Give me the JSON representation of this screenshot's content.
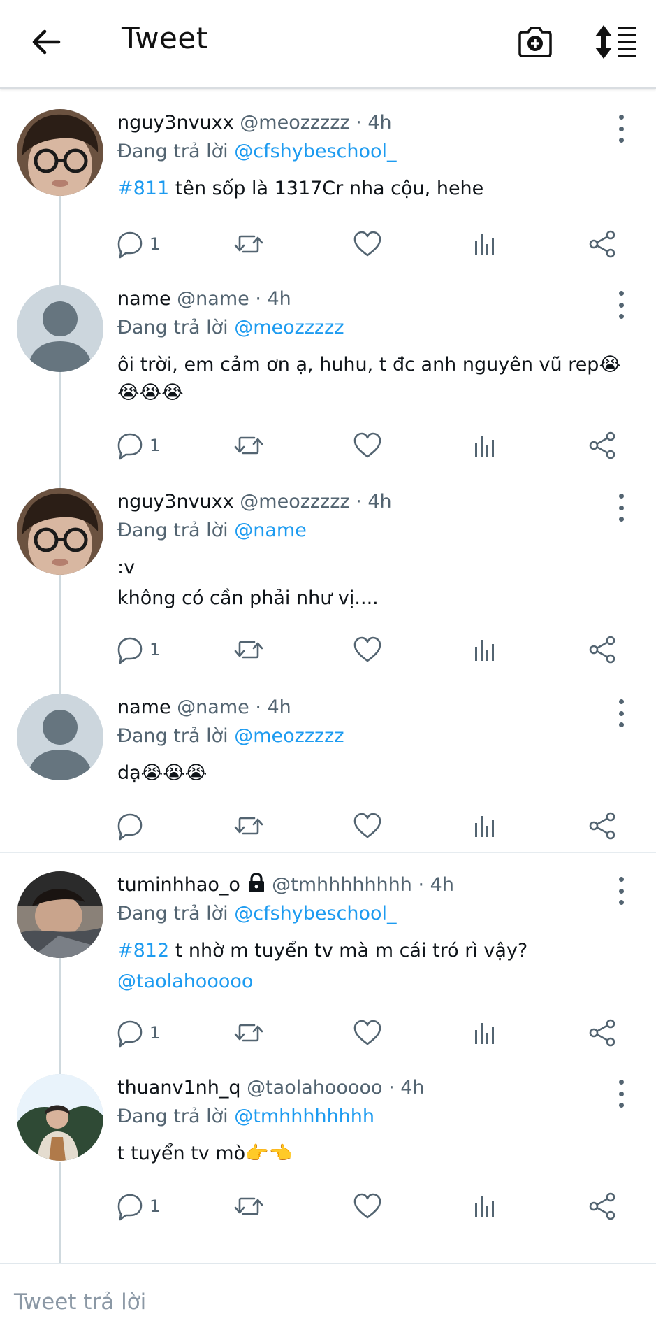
{
  "header": {
    "title": "Tweet"
  },
  "tweets": [
    {
      "display_name": "nguy3nvuxx",
      "handle": "@meozzzzz",
      "time": "· 4h",
      "reply_prefix": "Đang trả lời",
      "reply_to": "@cfshybeschool_",
      "hashtag": "#811",
      "text": " tên sốp là 1317Cr nha cộu, hehe",
      "reply_count": "1",
      "avatar": "photo-boy-glasses"
    },
    {
      "display_name": "name",
      "handle": "@name",
      "time": "· 4h",
      "reply_prefix": "Đang trả lời",
      "reply_to": "@meozzzzz",
      "text": "ôi trời, em cảm ơn ạ, huhu, t đc anh nguyên vũ rep😭😭😭😭",
      "reply_count": "1",
      "avatar": "default-avatar"
    },
    {
      "display_name": "nguy3nvuxx",
      "handle": "@meozzzzz",
      "time": "· 4h",
      "reply_prefix": "Đang trả lời",
      "reply_to": "@name",
      "text_line1": ":v",
      "text_line2": "không có cần phải như vị....",
      "reply_count": "1",
      "avatar": "photo-boy-glasses"
    },
    {
      "display_name": "name",
      "handle": "@name",
      "time": "· 4h",
      "reply_prefix": "Đang trả lời",
      "reply_to": "@meozzzzz",
      "text": "dạ😭😭😭",
      "reply_count": "",
      "avatar": "default-avatar"
    },
    {
      "display_name": "tuminhhao_o",
      "handle": "@tmhhhhhhhh",
      "time": "· 4h",
      "reply_prefix": "Đang trả lời",
      "reply_to": "@cfshybeschool_",
      "hashtag": "#812",
      "text": " t nhờ m tuyển tv mà m cái tró rì vậy?",
      "mention": "@taolahooooo",
      "reply_count": "1",
      "avatar": "photo-sleeping",
      "locked": true
    },
    {
      "display_name": "thuanv1nh_q",
      "handle": "@taolahooooo",
      "time": "· 4h",
      "reply_prefix": "Đang trả lời",
      "reply_to": "@tmhhhhhhhh",
      "text": "t tuyển tv mò👉👈",
      "reply_count": "1",
      "avatar": "photo-outdoor"
    }
  ],
  "composer": {
    "placeholder": "Tweet trả lời"
  },
  "icons": [
    "back-arrow-icon",
    "camera-plus-icon",
    "sort-icon",
    "more-vertical-icon",
    "reply-icon",
    "retweet-icon",
    "like-icon",
    "analytics-icon",
    "share-icon",
    "lock-icon"
  ],
  "colors": {
    "link": "#1d9bf0",
    "text": "#0f1419",
    "muted": "#536471",
    "thread_line": "#cfd9de"
  }
}
